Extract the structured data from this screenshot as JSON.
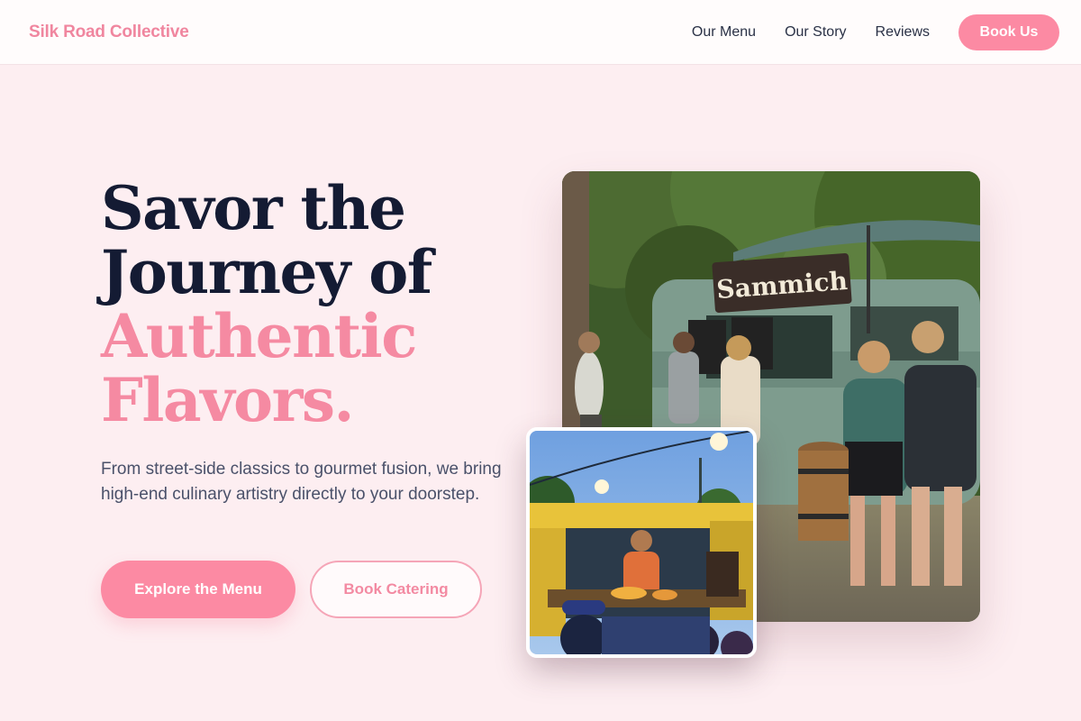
{
  "header": {
    "logo": "Silk Road Collective",
    "nav": [
      "Our Menu",
      "Our Story",
      "Reviews"
    ],
    "cta": "Book Us"
  },
  "hero": {
    "title_lines": [
      "Savor the",
      "Journey of"
    ],
    "title_accent_lines": [
      "Authentic",
      "Flavors."
    ],
    "subtitle": "From street-side classics to gourmet fusion, we bring high-end culinary artistry directly to your doorstep.",
    "primary_button": "Explore the Menu",
    "secondary_button": "Book Catering"
  },
  "images": {
    "main_sign": "Sammich"
  },
  "colors": {
    "accent": "#fc8aa3",
    "background": "#fdeef1",
    "heading": "#141b33"
  }
}
